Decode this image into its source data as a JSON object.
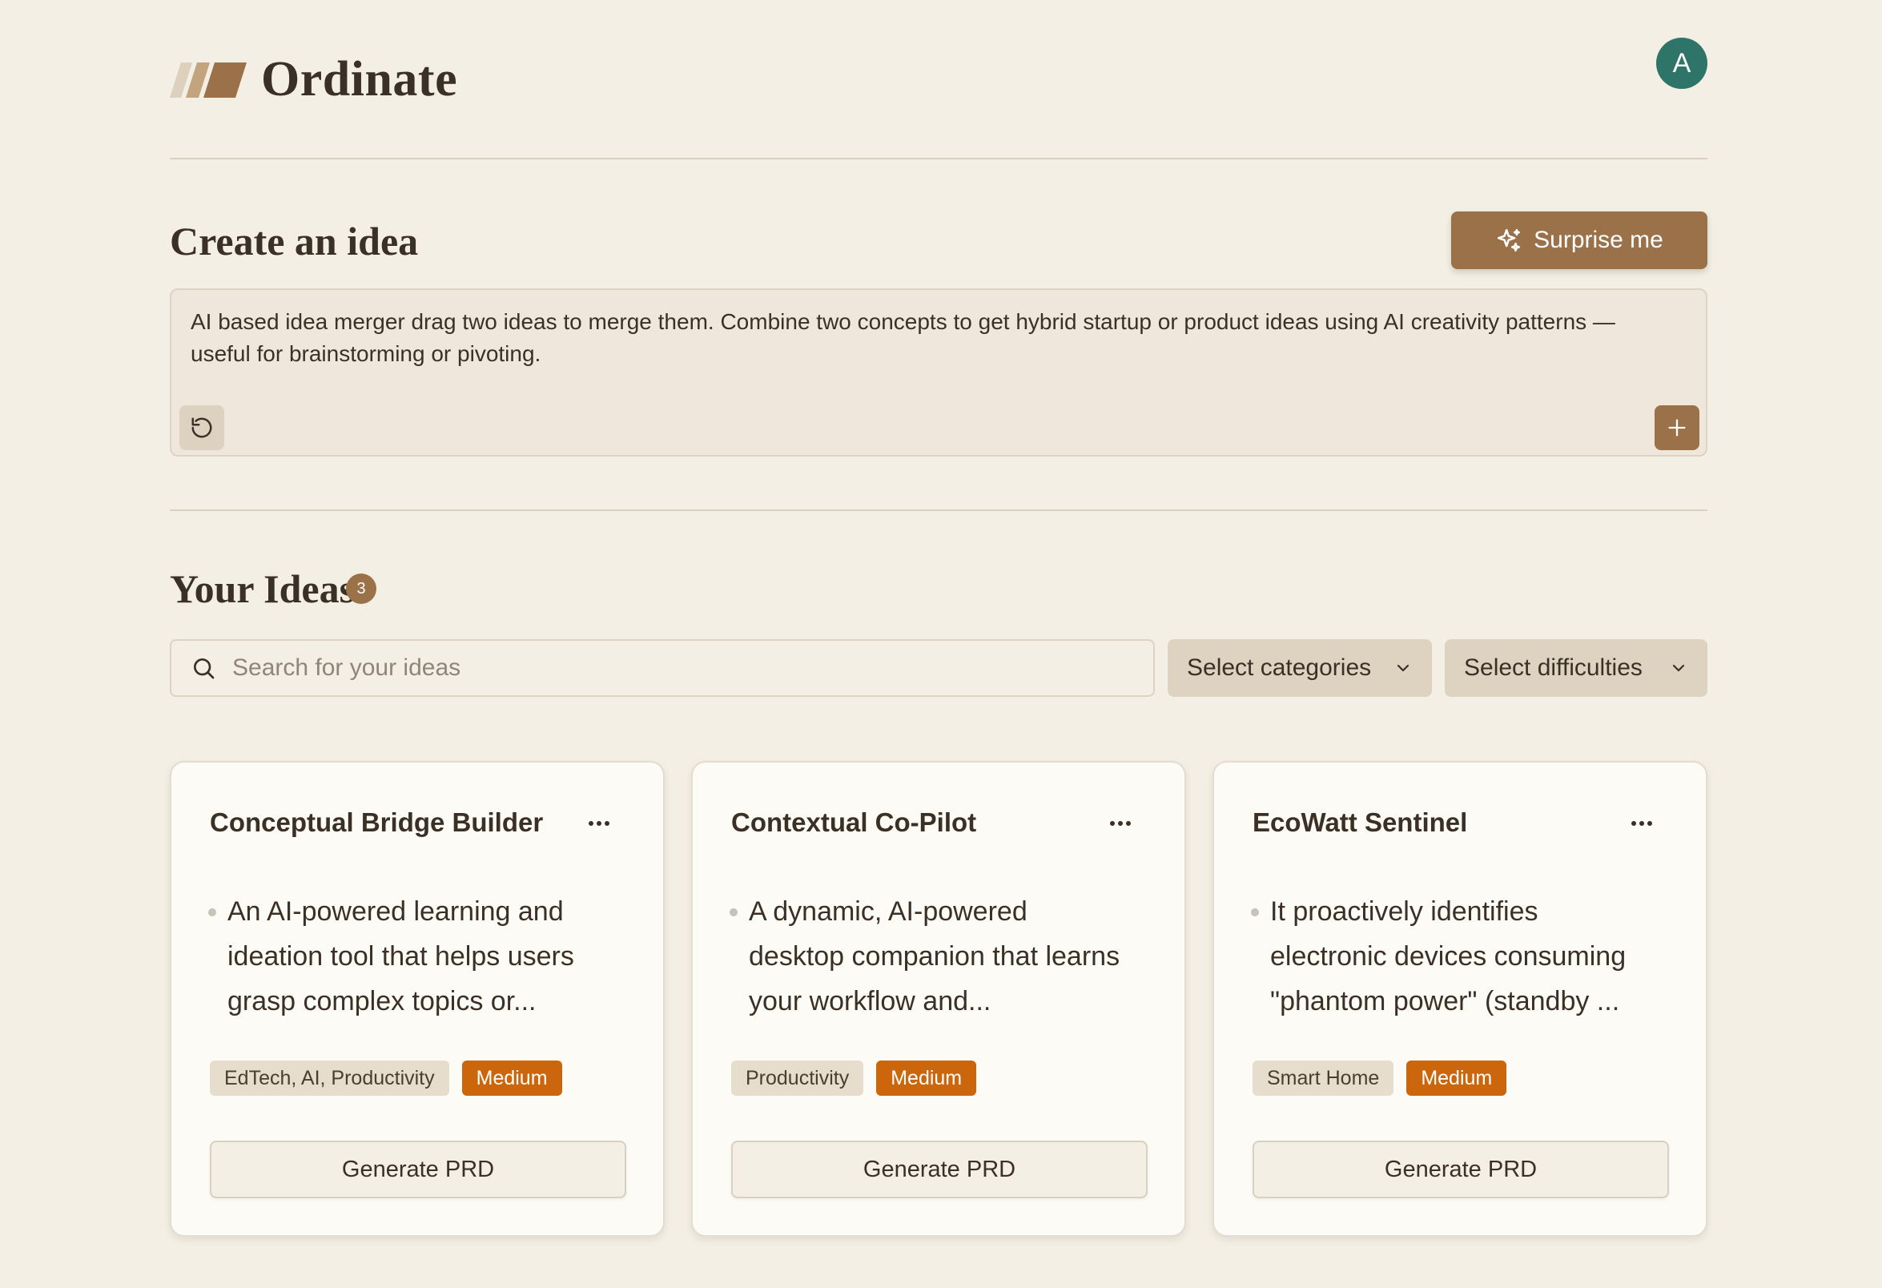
{
  "app": {
    "name": "Ordinate",
    "avatar_initial": "A",
    "accent": "#9a7148",
    "avatar_color": "#2f7468"
  },
  "create": {
    "title": "Create an idea",
    "surprise_label": "Surprise me",
    "idea_text": "AI based idea merger drag two ideas to merge them. Combine two concepts to get hybrid startup or product ideas using AI creativity patterns — useful for brainstorming or pivoting."
  },
  "ideas": {
    "title": "Your Ideas",
    "count": "3",
    "search_placeholder": "Search for your ideas",
    "categories_label": "Select categories",
    "difficulties_label": "Select difficulties",
    "generate_label": "Generate PRD",
    "cards": [
      {
        "title": "Conceptual Bridge Builder",
        "description": "An AI-powered learning and ideation tool that helps users grasp complex topics or...",
        "category": "EdTech, AI, Productivity",
        "difficulty": "Medium"
      },
      {
        "title": "Contextual Co-Pilot",
        "description": "A dynamic, AI-powered desktop companion that learns your workflow and...",
        "category": "Productivity",
        "difficulty": "Medium"
      },
      {
        "title": "EcoWatt Sentinel",
        "description": "It proactively identifies electronic devices consuming \"phantom power\" (standby ...",
        "category": "Smart Home",
        "difficulty": "Medium"
      }
    ]
  }
}
